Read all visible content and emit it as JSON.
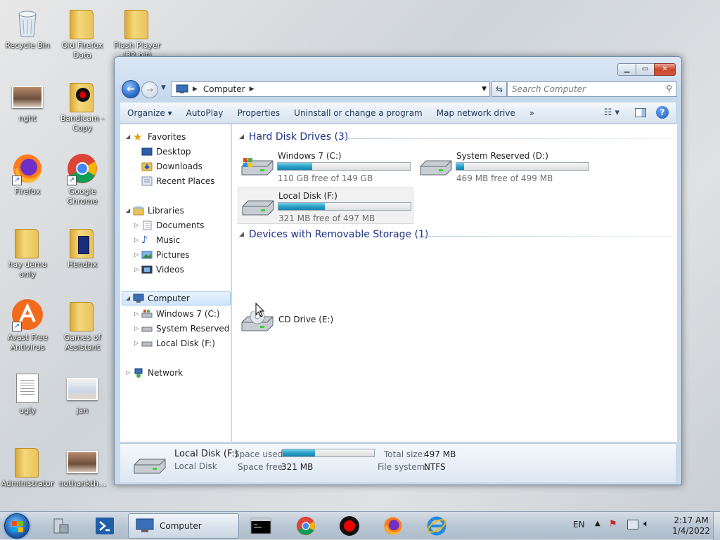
{
  "desktop": {
    "icons": [
      {
        "label": "Recycle Bin"
      },
      {
        "label": "Old Firefox Data"
      },
      {
        "label": "Flash Player (32 bit)"
      },
      {
        "label": "nght"
      },
      {
        "label": "Bandicam - Copy"
      },
      {
        "label": "Firefox"
      },
      {
        "label": "Google Chrome"
      },
      {
        "label": "hay demo only"
      },
      {
        "label": "Hendnx"
      },
      {
        "label": "Avast Free Antivirus"
      },
      {
        "label": "Games of Assistant"
      },
      {
        "label": "ugly"
      },
      {
        "label": "jan"
      },
      {
        "label": "Administrator"
      },
      {
        "label": "nothankth..."
      }
    ]
  },
  "window": {
    "address": {
      "crumb": "Computer"
    },
    "search": {
      "placeholder": "Search Computer"
    },
    "toolbar": {
      "organize": "Organize",
      "autoplay": "AutoPlay",
      "properties": "Properties",
      "uninstall": "Uninstall or change a program",
      "map_drive": "Map network drive",
      "more": "»"
    },
    "nav": {
      "favorites": "Favorites",
      "desktop": "Desktop",
      "downloads": "Downloads",
      "recent": "Recent Places",
      "libraries": "Libraries",
      "documents": "Documents",
      "music": "Music",
      "pictures": "Pictures",
      "videos": "Videos",
      "computer": "Computer",
      "win7": "Windows 7 (C:)",
      "sysres": "System Reserved (D:",
      "local": "Local Disk (F:)",
      "network": "Network"
    },
    "groups": {
      "hdd": "Hard Disk Drives (3)",
      "removable": "Devices with Removable Storage (1)"
    },
    "drives": [
      {
        "name": "Windows 7 (C:)",
        "free": "110 GB free of 149 GB",
        "used_fraction": 0.26
      },
      {
        "name": "System Reserved (D:)",
        "free": "469 MB free of 499 MB",
        "used_fraction": 0.06
      },
      {
        "name": "Local Disk (F:)",
        "free": "321 MB free of 497 MB",
        "used_fraction": 0.35
      }
    ],
    "cd": {
      "name": "CD Drive (E:)"
    },
    "details": {
      "name": "Local Disk (F:)",
      "type": "Local Disk",
      "space_used_label": "Space used:",
      "space_free_label": "Space free:",
      "space_free": "321 MB",
      "total_label": "Total size:",
      "total": "497 MB",
      "fs_label": "File system:",
      "fs": "NTFS",
      "used_fraction": 0.35
    }
  },
  "taskbar": {
    "task_label": "Computer",
    "lang": "EN",
    "time": "2:17 AM",
    "date": "1/4/2022"
  },
  "colors": {
    "accent": "#1e3287",
    "progress": "#2a9fc8"
  }
}
